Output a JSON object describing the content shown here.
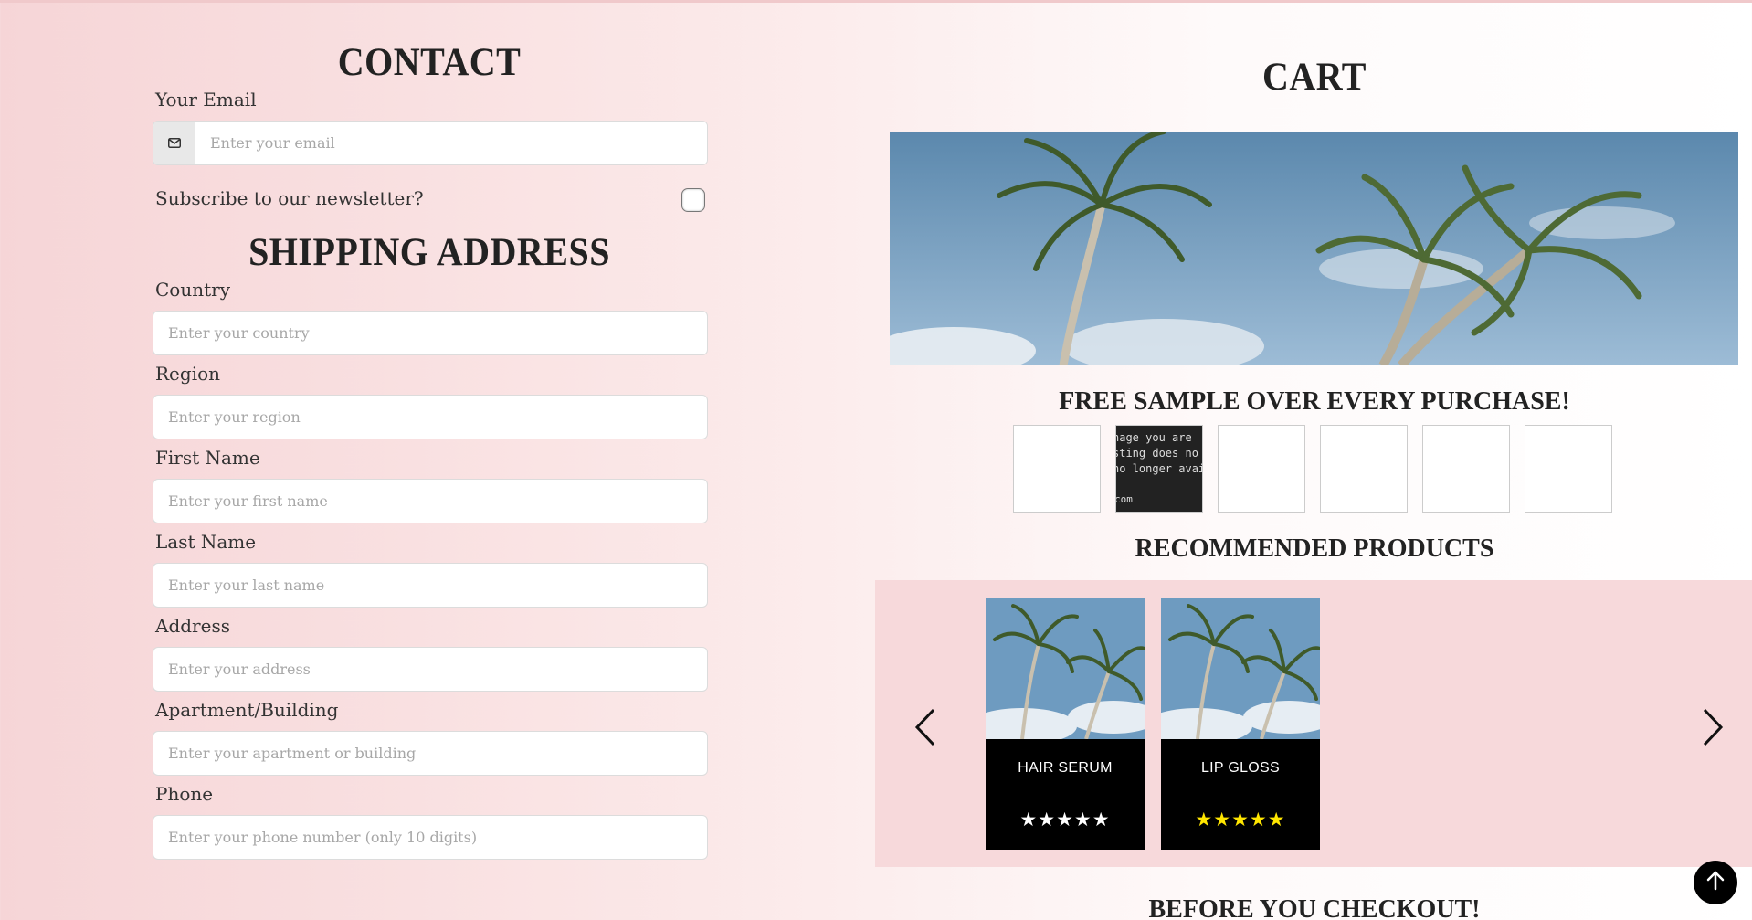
{
  "contact": {
    "title": "CONTACT",
    "email_label": "Your Email",
    "email_placeholder": "Enter your email",
    "subscribe_label": "Subscribe to our newsletter?"
  },
  "shipping": {
    "title": "SHIPPING ADDRESS",
    "fields": [
      {
        "label": "Country",
        "placeholder": "Enter your country"
      },
      {
        "label": "Region",
        "placeholder": "Enter your region"
      },
      {
        "label": "First Name",
        "placeholder": "Enter your first name"
      },
      {
        "label": "Last Name",
        "placeholder": "Enter your last name"
      },
      {
        "label": "Address",
        "placeholder": "Enter your address"
      },
      {
        "label": "Apartment/Building",
        "placeholder": "Enter your apartment or building"
      },
      {
        "label": "Phone",
        "placeholder": "Enter your phone number (only 10 digits)"
      }
    ]
  },
  "cart": {
    "title": "CART",
    "free_sample_title": "FREE SAMPLE OVER EVERY PURCHASE!",
    "broken_image_text": [
      "nage you are",
      "sting does no",
      "no longer avail"
    ],
    "broken_image_domain": "com",
    "recommended_title": "RECOMMENDED PRODUCTS",
    "products": [
      {
        "name": "HAIR SERUM",
        "stars": "★★★★★",
        "star_color": "#ffffff"
      },
      {
        "name": "LIP GLOSS",
        "stars": "★★★★★",
        "star_color": "#ffe600"
      }
    ],
    "before_checkout_title": "BEFORE YOU CHECKOUT!"
  },
  "icons": {
    "email": "envelope-icon",
    "prev": "chevron-left-icon",
    "next": "chevron-right-icon",
    "top": "arrow-up-icon"
  }
}
